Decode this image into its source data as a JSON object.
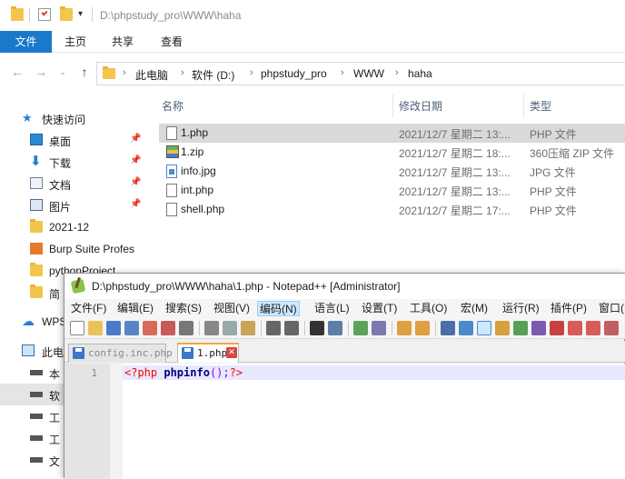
{
  "explorer": {
    "title": "D:\\phpstudy_pro\\WWW\\haha",
    "ribbon_tabs": [
      "文件",
      "主页",
      "共享",
      "查看"
    ],
    "breadcrumbs": [
      "此电脑",
      "软件 (D:)",
      "phpstudy_pro",
      "WWW",
      "haha"
    ],
    "columns": {
      "name": "名称",
      "date": "修改日期",
      "type": "类型"
    },
    "nav": [
      {
        "label": "快速访问",
        "icon": "star-icon"
      },
      {
        "label": "桌面",
        "icon": "desktop-icon",
        "pinned": true
      },
      {
        "label": "下载",
        "icon": "download-icon",
        "pinned": true
      },
      {
        "label": "文档",
        "icon": "documents-icon",
        "pinned": true
      },
      {
        "label": "图片",
        "icon": "pictures-icon",
        "pinned": true
      },
      {
        "label": "2021-12",
        "icon": "folder-icon"
      },
      {
        "label": "Burp Suite Profes",
        "icon": "burp-icon"
      },
      {
        "label": "pythonProject",
        "icon": "folder-icon"
      },
      {
        "label": "简",
        "icon": "folder-icon"
      },
      {
        "label": "WPS",
        "icon": "cloud-icon"
      },
      {
        "label": "此电",
        "icon": "computer-icon"
      },
      {
        "label": "本",
        "icon": "drive-icon"
      },
      {
        "label": "软",
        "icon": "drive-icon"
      },
      {
        "label": "工",
        "icon": "drive-icon"
      },
      {
        "label": "工",
        "icon": "drive-icon"
      },
      {
        "label": "文",
        "icon": "drive-icon"
      }
    ],
    "files": [
      {
        "name": "1.php",
        "date": "2021/12/7 星期二 13:...",
        "type": "PHP 文件",
        "icon": "php-file-icon",
        "selected": true
      },
      {
        "name": "1.zip",
        "date": "2021/12/7 星期二 18:...",
        "type": "360压缩 ZIP 文件",
        "icon": "zip-file-icon"
      },
      {
        "name": "info.jpg",
        "date": "2021/12/7 星期二 13:...",
        "type": "JPG 文件",
        "icon": "jpg-file-icon"
      },
      {
        "name": "int.php",
        "date": "2021/12/7 星期二 13:...",
        "type": "PHP 文件",
        "icon": "php-file-icon"
      },
      {
        "name": "shell.php",
        "date": "2021/12/7 星期二 17:...",
        "type": "PHP 文件",
        "icon": "php-file-icon"
      }
    ]
  },
  "notepad": {
    "title": "D:\\phpstudy_pro\\WWW\\haha\\1.php - Notepad++ [Administrator]",
    "menu": [
      "文件(F)",
      "编辑(E)",
      "搜索(S)",
      "视图(V)",
      "编码(N)",
      "语言(L)",
      "设置(T)",
      "工具(O)",
      "宏(M)",
      "运行(R)",
      "插件(P)",
      "窗口("
    ],
    "tabs": [
      {
        "label": "config.inc.php",
        "active": false
      },
      {
        "label": "1.php",
        "active": true
      }
    ],
    "close_glyph": "✕",
    "line_number": "1",
    "code": {
      "open_tag": "<?php",
      "fn": "phpinfo",
      "punct": "();",
      "close_tag": "?>"
    }
  },
  "colors": {
    "file_tab": "#1979ca",
    "selection": "#d9d9d9",
    "active_tab_accent": "#f4a640",
    "php_tag": "#ff0000",
    "php_func": "#000080"
  }
}
